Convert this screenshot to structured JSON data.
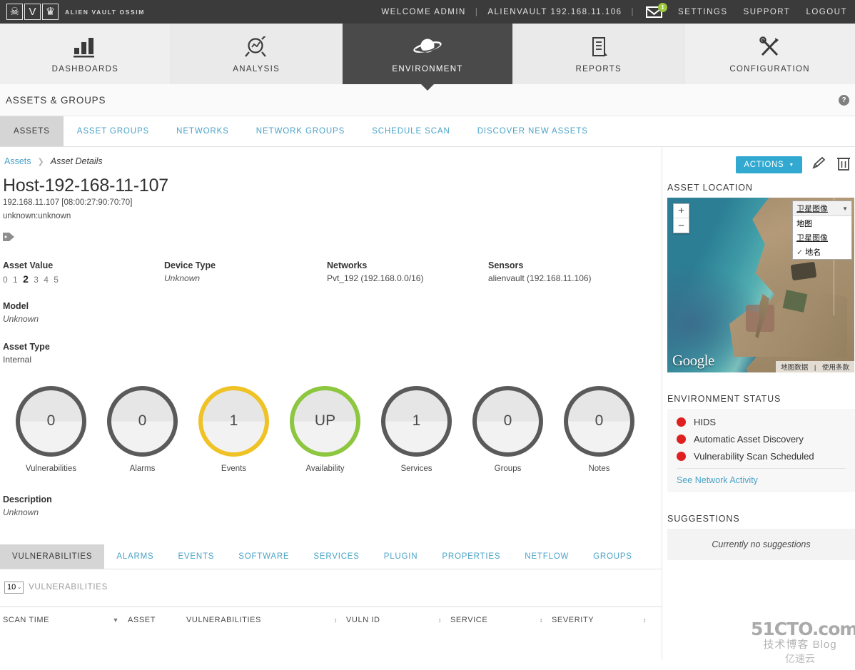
{
  "topbar": {
    "brand_text": "ALIEN VAULT OSSIM",
    "logo_glyph_1": "☠",
    "logo_glyph_2": "V",
    "logo_glyph_3": "♛",
    "welcome": "WELCOME ADMIN",
    "sep1": "|",
    "server": "ALIENVAULT 192.168.11.106",
    "sep2": "|",
    "mail_badge": "1",
    "settings": "SETTINGS",
    "support": "SUPPORT",
    "logout": "LOGOUT"
  },
  "mainnav": [
    {
      "label": "DASHBOARDS",
      "icon": "bar-chart-icon",
      "active": false
    },
    {
      "label": "ANALYSIS",
      "icon": "magnifier-chart-icon",
      "active": false
    },
    {
      "label": "ENVIRONMENT",
      "icon": "planet-icon",
      "active": true
    },
    {
      "label": "REPORTS",
      "icon": "document-icon",
      "active": false
    },
    {
      "label": "CONFIGURATION",
      "icon": "tools-icon",
      "active": false
    }
  ],
  "page": {
    "title": "ASSETS & GROUPS",
    "help_glyph": "?"
  },
  "subtabs": [
    {
      "label": "ASSETS",
      "active": true
    },
    {
      "label": "ASSET GROUPS",
      "active": false
    },
    {
      "label": "NETWORKS",
      "active": false
    },
    {
      "label": "NETWORK GROUPS",
      "active": false
    },
    {
      "label": "SCHEDULE SCAN",
      "active": false
    },
    {
      "label": "DISCOVER NEW ASSETS",
      "active": false
    }
  ],
  "breadcrumb": {
    "root": "Assets",
    "separator": "❯",
    "current": "Asset Details"
  },
  "toolbar": {
    "actions_label": "ACTIONS",
    "actions_caret": "▼",
    "edit_icon": "pencil-icon",
    "delete_icon": "trash-icon",
    "accent": "#31a9d1"
  },
  "asset": {
    "name": "Host-192-168-11-107",
    "ip_mac": "192.168.11.107 [08:00:27:90:70:70]",
    "os": "unknown:unknown",
    "tag_icon": "tag-icon",
    "asset_value_label": "Asset Value",
    "asset_value_scale": [
      "0",
      "1",
      "2",
      "3",
      "4",
      "5"
    ],
    "asset_value_selected": "2",
    "device_type_label": "Device Type",
    "device_type": "Unknown",
    "networks_label": "Networks",
    "networks": "Pvt_192 (192.168.0.0/16)",
    "sensors_label": "Sensors",
    "sensors": "alienvault (192.168.11.106)",
    "model_label": "Model",
    "model": "Unknown",
    "asset_type_label": "Asset Type",
    "asset_type": "Internal",
    "description_label": "Description",
    "description": "Unknown"
  },
  "metrics": [
    {
      "value": "0",
      "label": "Vulnerabilities",
      "color": "#5a5a5a"
    },
    {
      "value": "0",
      "label": "Alarms",
      "color": "#5a5a5a"
    },
    {
      "value": "1",
      "label": "Events",
      "color": "#efc225"
    },
    {
      "value": "UP",
      "label": "Availability",
      "color": "#8dc63f"
    },
    {
      "value": "1",
      "label": "Services",
      "color": "#5a5a5a"
    },
    {
      "value": "0",
      "label": "Groups",
      "color": "#5a5a5a"
    },
    {
      "value": "0",
      "label": "Notes",
      "color": "#5a5a5a"
    }
  ],
  "bottom_tabs": [
    {
      "label": "VULNERABILITIES",
      "active": true
    },
    {
      "label": "ALARMS",
      "active": false
    },
    {
      "label": "EVENTS",
      "active": false
    },
    {
      "label": "SOFTWARE",
      "active": false
    },
    {
      "label": "SERVICES",
      "active": false
    },
    {
      "label": "PLUGIN",
      "active": false
    },
    {
      "label": "PROPERTIES",
      "active": false
    },
    {
      "label": "NETFLOW",
      "active": false
    },
    {
      "label": "GROUPS",
      "active": false
    }
  ],
  "table": {
    "page_size": "10",
    "page_size_caret": "⌄",
    "entity_label": "VULNERABILITIES",
    "columns": [
      {
        "label": "SCAN TIME",
        "sort": "▼"
      },
      {
        "label": "ASSET",
        "sort": ""
      },
      {
        "label": "VULNERABILITIES",
        "sort": "↕"
      },
      {
        "label": "VULN ID",
        "sort": "↕"
      },
      {
        "label": "SERVICE",
        "sort": "↕"
      },
      {
        "label": "SEVERITY",
        "sort": "↕"
      }
    ]
  },
  "sidebar": {
    "asset_location_title": "ASSET LOCATION",
    "map": {
      "zoom_in": "+",
      "zoom_out": "−",
      "type_selected": "卫星图像",
      "type_caret": "▼",
      "type_options": [
        "地图",
        "卫星图像"
      ],
      "labels_checkbox": "✓",
      "labels_option": "地名",
      "provider": "Google",
      "footer_data": "地图数据",
      "footer_sep": "|",
      "footer_terms": "使用条款"
    },
    "environment_status_title": "ENVIRONMENT STATUS",
    "status_items": [
      {
        "label": "HIDS",
        "color": "#e02020"
      },
      {
        "label": "Automatic Asset Discovery",
        "color": "#e02020"
      },
      {
        "label": "Vulnerability Scan Scheduled",
        "color": "#e02020"
      }
    ],
    "network_activity_link": "See Network Activity",
    "suggestions_title": "SUGGESTIONS",
    "suggestions_empty": "Currently no suggestions"
  },
  "watermark": {
    "line1": "51CTO.com",
    "line2": "技术博客",
    "line2b": "Blog",
    "line3": "亿速云"
  }
}
